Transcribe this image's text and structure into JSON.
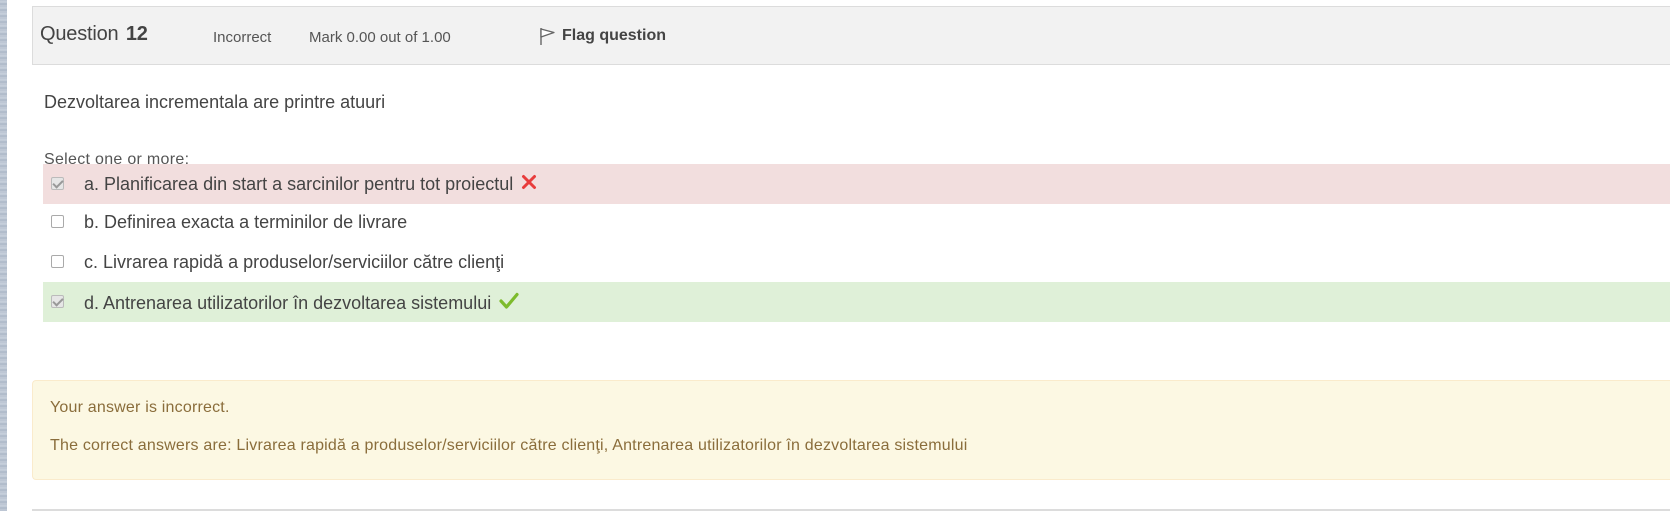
{
  "question": {
    "title_prefix": "Question",
    "number": "12",
    "state": "Incorrect",
    "grade": "Mark 0.00 out of 1.00",
    "flag_label": "Flag question",
    "text": "Dezvoltarea incrementala are printre atuuri",
    "prompt": "Select one or more:"
  },
  "answers": [
    {
      "label": "a. Planificarea din start a sarcinilor pentru tot proiectul",
      "checked": true,
      "status": "incorrect",
      "mark_icon": "cross-icon"
    },
    {
      "label": "b. Definirea exacta a terminilor de livrare",
      "checked": false,
      "status": "none"
    },
    {
      "label": "c. Livrarea rapidă a produselor/serviciilor către clienţi",
      "checked": false,
      "status": "none"
    },
    {
      "label": "d. Antrenarea utilizatorilor în dezvoltarea sistemului",
      "checked": true,
      "status": "correct",
      "mark_icon": "check-icon"
    }
  ],
  "feedback": {
    "result": "Your answer is incorrect.",
    "correct_answers": "The correct answers are: Livrarea rapidă a produselor/serviciilor către clienţi, Antrenarea utilizatorilor în dezvoltarea sistemului"
  },
  "colors": {
    "incorrect_bg": "#f2dede",
    "correct_bg": "#dff0d8",
    "feedback_bg": "#fcf8e3",
    "cross": "#e83c3c",
    "check": "#7dbb2c"
  }
}
